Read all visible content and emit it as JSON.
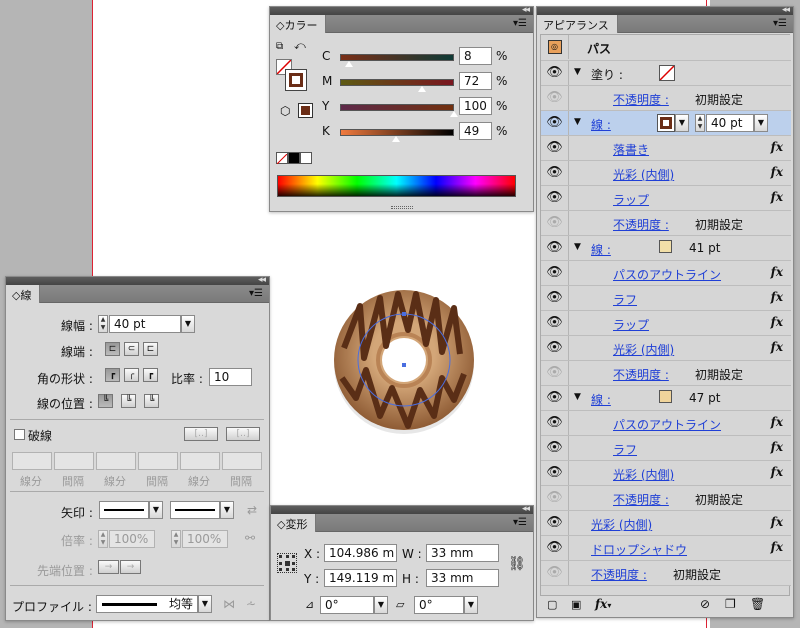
{
  "color_panel": {
    "tab": "カラー",
    "channels": [
      {
        "label": "C",
        "value": "8",
        "percent": 8
      },
      {
        "label": "M",
        "value": "72",
        "percent": 72
      },
      {
        "label": "Y",
        "value": "100",
        "percent": 100
      },
      {
        "label": "K",
        "value": "49",
        "percent": 49
      }
    ],
    "unit": "%",
    "stroke_color": "#6b2d16",
    "fill_color": "#6b2d16"
  },
  "stroke_panel": {
    "tab": "線",
    "weight_label": "線幅 :",
    "weight_value": "40 pt",
    "cap_label": "線端 :",
    "corner_label": "角の形状 :",
    "miter_label": "比率 :",
    "miter_value": "10",
    "align_label": "線の位置 :",
    "dashed_label": "破線",
    "dash_labels": [
      "線分",
      "間隔",
      "線分",
      "間隔",
      "線分",
      "間隔"
    ],
    "arrow_label": "矢印 :",
    "scale_label": "倍率 :",
    "scale_value_1": "100%",
    "scale_value_2": "100%",
    "align_tip_label": "先端位置 :",
    "profile_label": "プロファイル :",
    "profile_value": "均等"
  },
  "transform_panel": {
    "tab": "変形",
    "x_label": "X :",
    "x_value": "104.986 m",
    "y_label": "Y :",
    "y_value": "149.119 m",
    "w_label": "W :",
    "w_value": "33 mm",
    "h_label": "H :",
    "h_value": "33 mm",
    "rotate_value": "0°",
    "shear_value": "0°"
  },
  "appearance_panel": {
    "tab": "アピアランス",
    "header": "パス",
    "fill_label": "塗り :",
    "stroke_label": "線 :",
    "opacity_label": "不透明度 :",
    "opacity_value": "初期設定",
    "stroke1_weight": "40 pt",
    "stroke2_weight": "41 pt",
    "stroke3_weight": "47 pt",
    "effects": {
      "scribble": "落書き",
      "inner_glow": "光彩 (内側)",
      "roughen": "ラフ",
      "pucker": "ラップ",
      "outline": "パスのアウトライン",
      "drop_shadow": "ドロップシャドウ"
    },
    "fx_label": "fx",
    "stroke_swatch_color": "#f2dfa8",
    "stroke3_swatch_color": "#f0d49b"
  }
}
